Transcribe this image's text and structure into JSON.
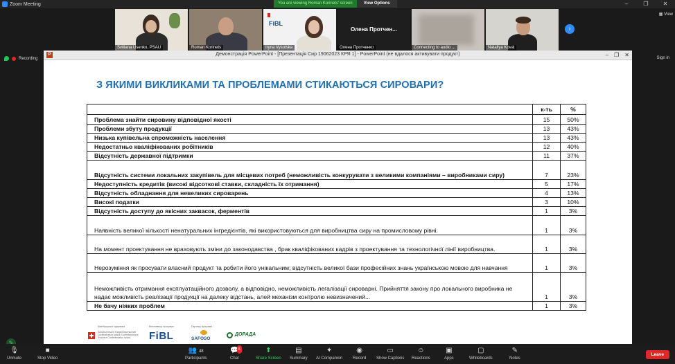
{
  "window": {
    "title": "Zoom Meeting",
    "controls": [
      "–",
      "❐",
      "✕"
    ]
  },
  "share_banner": {
    "viewing": "You are viewing Roman Korinets' screen",
    "view_options": "View Options"
  },
  "participants": [
    {
      "name": "Svitlana Usenko, PSAU"
    },
    {
      "name": "Roman Korinets"
    },
    {
      "name": "Iryna Vysotska"
    },
    {
      "name": "Олена Протченко",
      "card": "Олена  Протчен..."
    },
    {
      "name": "Connecting to audio ..."
    },
    {
      "name": "Nataliya Koval"
    }
  ],
  "view_label": "View",
  "recording_label": "Recording",
  "sign_in": "Sign in",
  "ppt": {
    "app_icon": "P",
    "window_title": "Демонстрація PowerPoint - [Презентація Сир 19062023 КРЯ 1] - PowerPoint (не вдалося активувати продукт)",
    "controls": [
      "–",
      "❐",
      "✕"
    ]
  },
  "slide": {
    "title": "З ЯКИМИ ВИКЛИКАМИ ТА ПРОБЛЕМАМИ СТИКАЮТЬСЯ СИРОВАРИ?",
    "table": {
      "headers": [
        "",
        "к-ть",
        "%"
      ],
      "rows": [
        {
          "text": "Проблема знайти сировину відповідної якості",
          "count": "15",
          "pct": "50%"
        },
        {
          "text": "Проблеми збуту продукції",
          "count": "13",
          "pct": "43%"
        },
        {
          "text": "Низька купівельна спроможність населення",
          "count": "13",
          "pct": "43%"
        },
        {
          "text": "Недостатньо кваліфікованих робітників",
          "count": "12",
          "pct": "40%"
        },
        {
          "text": "Відсутність державної підтримки",
          "count": "11",
          "pct": "37%"
        },
        {
          "text": "Відсутність системи локальних закупівель для місцевих потреб (неможливість конкурувати з великими компаніями – виробниками сиру)",
          "count": "7",
          "pct": "23%"
        },
        {
          "text": "Недоступність кредитів (високі відсоткові ставки, складність їх отримання)",
          "count": "5",
          "pct": "17%"
        },
        {
          "text": "Відсутність обладнання для невеликих сироварень",
          "count": "4",
          "pct": "13%"
        },
        {
          "text": "Високі податки",
          "count": "3",
          "pct": "10%"
        },
        {
          "text": "Відсутність доступу до якісних заквасок, ферментів",
          "count": "1",
          "pct": "3%"
        },
        {
          "text": "Наявність великої кількості ненатуральних інгредієнтів, які використовуються для виробництва сиру на промисловому рівні.",
          "count": "1",
          "pct": "3%"
        },
        {
          "text": "На момент проектування не враховують зміни до законодавства , брак кваліфікованих кадрів з проектування та технологічної лінії виробництва.",
          "count": "1",
          "pct": "3%"
        },
        {
          "text": "Нерозуміння як просувати власний продукт та робити його унікальним; відсутність великої бази професійних знань українською мовою для навчання",
          "count": "1",
          "pct": "3%"
        },
        {
          "text": "Неможливість отримання експлуатаційного дозволу, а відповідно, неможливість легалізації сироварні. Прийняття закону про локального виробника не надає можливість реалізації продукції на далеку відстань, алей механізм контролю невизначений...",
          "count": "1",
          "pct": "3%"
        },
        {
          "text": "Не бачу ніяких проблем",
          "count": "1",
          "pct": "3%"
        }
      ]
    },
    "logos": {
      "swiss_caption": "Швейцарська підтримка",
      "swiss_text": "Schweizerische Eidgenossenschaft Confédération suisse Confederazione Svizzera Confederaziun svizra",
      "fibl_caption": "Виконавець програми",
      "fibl": "FiBL",
      "safoso_caption": "Партнер програми",
      "safoso": "SAFOSO",
      "dorada": "ДОРАДА"
    }
  },
  "toolbar": {
    "items": [
      {
        "label": "Unmute",
        "icon": "microphone-muted-icon"
      },
      {
        "label": "Stop Video",
        "icon": "video-camera-icon"
      },
      {
        "label": "Participants",
        "icon": "participants-icon",
        "count": "48"
      },
      {
        "label": "Chat",
        "icon": "chat-icon",
        "badge": "6"
      },
      {
        "label": "Share Screen",
        "icon": "share-screen-icon"
      },
      {
        "label": "Summary",
        "icon": "summary-icon"
      },
      {
        "label": "AI Companion",
        "icon": "ai-companion-icon"
      },
      {
        "label": "Record",
        "icon": "record-icon"
      },
      {
        "label": "Show Captions",
        "icon": "captions-icon"
      },
      {
        "label": "Reactions",
        "icon": "reactions-icon"
      },
      {
        "label": "Apps",
        "icon": "apps-icon"
      },
      {
        "label": "Whiteboards",
        "icon": "whiteboard-icon"
      },
      {
        "label": "Notes",
        "icon": "notes-icon"
      }
    ],
    "leave": "Leave"
  }
}
